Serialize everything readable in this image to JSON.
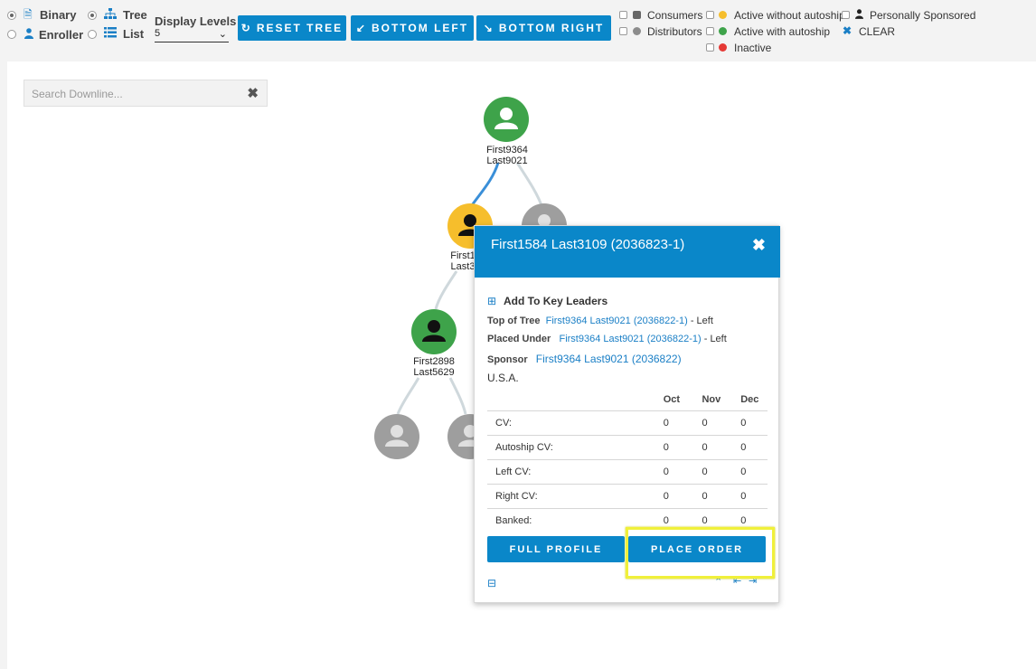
{
  "toolbar": {
    "binary_label": "Binary",
    "enroller_label": "Enroller",
    "tree_label": "Tree",
    "list_label": "List",
    "levels_label": "Display Levels",
    "levels_value": "5",
    "reset_label": "RESET TREE",
    "bottom_left_label": "BOTTOM LEFT",
    "bottom_right_label": "BOTTOM RIGHT"
  },
  "legend": {
    "consumers": "Consumers",
    "distributors": "Distributors",
    "active_without_autoship": "Active without autoship",
    "active_with_autoship": "Active with autoship",
    "inactive": "Inactive",
    "personally_sponsored": "Personally Sponsored",
    "clear": "CLEAR",
    "colors": {
      "consumer": "#666666",
      "distributor": "#8c8c8c",
      "active_without_autoship": "#f6be2c",
      "active_with_autoship": "#3ea34a",
      "inactive": "#e53935"
    }
  },
  "search": {
    "placeholder": "Search Downline..."
  },
  "tree": {
    "root": {
      "first": "First9364",
      "last": "Last9021"
    },
    "left": {
      "first": "First1",
      "last": "Last3"
    },
    "left_left": {
      "first": "First2898",
      "last": "Last5629"
    }
  },
  "popup": {
    "title": "First1584 Last3109 (2036823-1)",
    "add_key_leaders": "Add To Key Leaders",
    "top_of_tree_label": "Top of Tree",
    "top_of_tree_value": "First9364 Last9021 (2036822-1)",
    "top_of_tree_side": "- Left",
    "placed_under_label": "Placed Under",
    "placed_under_value": "First9364 Last9021 (2036822-1)",
    "placed_under_side": "- Left",
    "sponsor_label": "Sponsor",
    "sponsor_value": "First9364 Last9021 (2036822)",
    "country": "U.S.A.",
    "months": [
      "Oct",
      "Nov",
      "Dec"
    ],
    "rows": [
      {
        "label": "CV:",
        "values": [
          "0",
          "0",
          "0"
        ]
      },
      {
        "label": "Autoship CV:",
        "values": [
          "0",
          "0",
          "0"
        ]
      },
      {
        "label": "Left CV:",
        "values": [
          "0",
          "0",
          "0"
        ]
      },
      {
        "label": "Right CV:",
        "values": [
          "0",
          "0",
          "0"
        ]
      },
      {
        "label": "Banked:",
        "values": [
          "0",
          "0",
          "0"
        ]
      }
    ],
    "full_profile_label": "FULL PROFILE",
    "place_order_label": "PLACE ORDER"
  }
}
